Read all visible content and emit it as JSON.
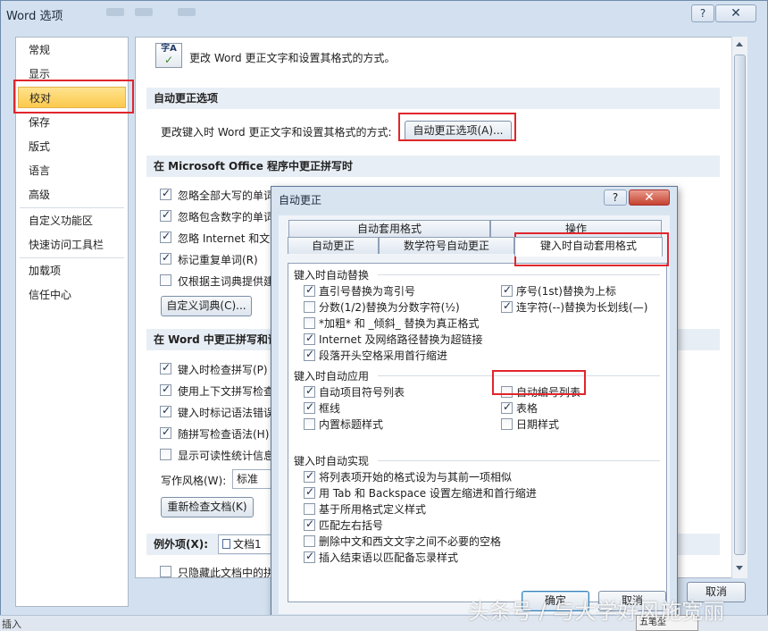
{
  "word_options": {
    "title": "Word 选项",
    "help": "?",
    "close": "✕",
    "sidebar": [
      "常规",
      "显示",
      "校对",
      "保存",
      "版式",
      "语言",
      "高级",
      "自定义功能区",
      "快速访问工具栏",
      "加载项",
      "信任中心"
    ],
    "header_text": "更改 Word 更正文字和设置其格式的方式。",
    "icon_text": "字A",
    "section_autocorrect": "自动更正选项",
    "autocorrect_desc": "更改键入时 Word 更正文字和设置其格式的方式:",
    "autocorrect_btn": "自动更正选项(A)...",
    "section_office": "在 Microsoft Office 程序中更正拼写时",
    "office_options": [
      {
        "label": "忽略全部大写的单词",
        "checked": true
      },
      {
        "label": "忽略包含数字的单词",
        "checked": true
      },
      {
        "label": "忽略 Internet 和文件",
        "checked": true
      },
      {
        "label": "标记重复单词(R)",
        "checked": true
      },
      {
        "label": "仅根据主词典提供建",
        "checked": false
      }
    ],
    "custom_dict_btn": "自定义词典(C)...",
    "section_word": "在 Word 中更正拼写和语",
    "word_options": [
      {
        "label": "键入时检查拼写(P)",
        "checked": true
      },
      {
        "label": "使用上下文拼写检查",
        "checked": true
      },
      {
        "label": "键入时标记语法错误",
        "checked": true
      },
      {
        "label": "随拼写检查语法(H)",
        "checked": true
      },
      {
        "label": "显示可读性统计信息",
        "checked": false
      }
    ],
    "style_label": "写作风格(W):",
    "style_value": "标准",
    "recheck_btn": "重新检查文档(K)",
    "exceptions_label": "例外项(X):",
    "exceptions_value": "文档1",
    "last_option": "只隐藏此文档中的拼",
    "cancel_btn": "取消"
  },
  "autocorrect_dialog": {
    "title": "自动更正",
    "help": "?",
    "close": "✕",
    "tabs_back": [
      "自动套用格式",
      "操作"
    ],
    "tabs_front": [
      "自动更正",
      "数学符号自动更正",
      "键入时自动套用格式"
    ],
    "group1_title": "键入时自动替换",
    "group1_left": [
      {
        "label": "直引号替换为弯引号",
        "checked": true
      },
      {
        "label": "分数(1/2)替换为分数字符(½)",
        "checked": false
      },
      {
        "label": "*加粗* 和 _倾斜_ 替换为真正格式",
        "checked": false
      },
      {
        "label": "Internet 及网络路径替换为超链接",
        "checked": true
      },
      {
        "label": "段落开头空格采用首行缩进",
        "checked": true
      }
    ],
    "group1_right": [
      {
        "label": "序号(1st)替换为上标",
        "checked": true
      },
      {
        "label": "连字符(--)替换为长划线(—)",
        "checked": true
      }
    ],
    "group2_title": "键入时自动应用",
    "group2_left": [
      {
        "label": "自动项目符号列表",
        "checked": true
      },
      {
        "label": "框线",
        "checked": true
      },
      {
        "label": "内置标题样式",
        "checked": false
      }
    ],
    "group2_right": [
      {
        "label": "自动编号列表",
        "checked": false
      },
      {
        "label": "表格",
        "checked": true
      },
      {
        "label": "日期样式",
        "checked": false
      }
    ],
    "group3_title": "键入时自动实现",
    "group3": [
      {
        "label": "将列表项开始的格式设为与其前一项相似",
        "checked": true
      },
      {
        "label": "用 Tab 和 Backspace 设置左缩进和首行缩进",
        "checked": true
      },
      {
        "label": "基于所用格式定义样式",
        "checked": false
      },
      {
        "label": "匹配左右括号",
        "checked": true
      },
      {
        "label": "删除中文和西文文字之间不必要的空格",
        "checked": false
      },
      {
        "label": "插入结束语以匹配备忘录样式",
        "checked": true
      }
    ],
    "ok_btn": "确定",
    "cancel_btn": "取消"
  },
  "status_bar": {
    "text": "插入",
    "ime": "五笔型"
  },
  "watermark": "头条号 / 与大学好风施宽丽",
  "colors": {
    "highlight_red": "#e0262c",
    "selected_nav": "#fcc94c"
  }
}
